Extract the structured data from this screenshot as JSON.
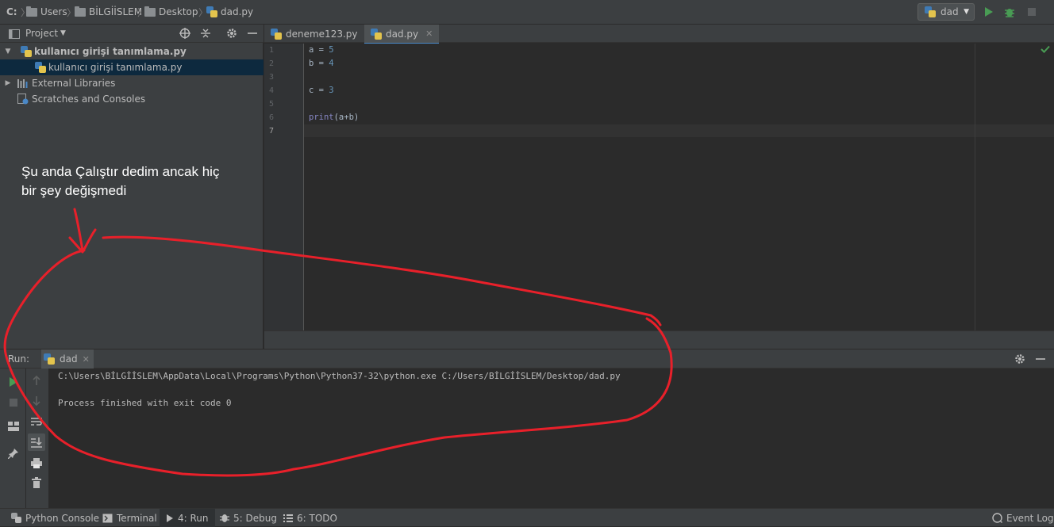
{
  "breadcrumbs": [
    "C:",
    "Users",
    "BİLGİİSLEM",
    "Desktop",
    "dad.py"
  ],
  "run_config": {
    "label": "dad"
  },
  "project": {
    "title": "Project",
    "tree": [
      {
        "label": "kullanıcı girişi tanımlama.py",
        "icon": "python-file-icon",
        "bold": true
      },
      {
        "label": "kullanıcı girişi tanımlama.py",
        "icon": "python-file-icon",
        "selected": true
      },
      {
        "label": "External Libraries",
        "icon": "library-icon"
      },
      {
        "label": "Scratches and Consoles",
        "icon": "scratches-icon"
      }
    ]
  },
  "editor": {
    "tabs": [
      {
        "label": "deneme123.py",
        "active": false
      },
      {
        "label": "dad.py",
        "active": true
      }
    ],
    "line_numbers": [
      "1",
      "2",
      "3",
      "4",
      "5",
      "6",
      "7"
    ],
    "code": {
      "l1_var": "a",
      "l1_eq": " = ",
      "l1_val": "5",
      "l2_var": "b",
      "l2_eq": " = ",
      "l2_val": "4",
      "l4_var": "c",
      "l4_eq": " = ",
      "l4_val": "3",
      "l6_fn": "print",
      "l6_args": "(a+b)"
    }
  },
  "run_panel": {
    "label": "Run:",
    "tab": "dad",
    "output": [
      "C:\\Users\\BİLGİİSLEM\\AppData\\Local\\Programs\\Python\\Python37-32\\python.exe C:/Users/BİLGİİSLEM/Desktop/dad.py",
      "Process finished with exit code 0"
    ]
  },
  "bottom_tabs": [
    {
      "label": "Python Console",
      "icon": "python-console-icon"
    },
    {
      "label": "Terminal",
      "icon": "terminal-icon"
    },
    {
      "label": "4: Run",
      "icon": "run-icon",
      "active": true
    },
    {
      "label": "5: Debug",
      "icon": "debug-icon"
    },
    {
      "label": "6: TODO",
      "icon": "todo-icon"
    }
  ],
  "event_log": "Event Log",
  "annotation": {
    "text_line1": "Şu anda Çalıştır dedim ancak hiç",
    "text_line2": "bir şey değişmedi",
    "color": "#e8202a"
  },
  "colors": {
    "accent": "#4a88c7",
    "run_green": "#499c54",
    "number": "#6897bb",
    "keyword": "#8888c6"
  }
}
